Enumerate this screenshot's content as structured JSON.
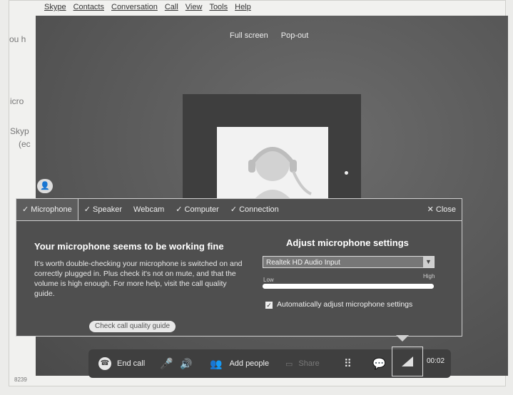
{
  "menu": [
    "Skype",
    "Contacts",
    "Conversation",
    "Call",
    "View",
    "Tools",
    "Help"
  ],
  "side_fragments": [
    "ou h",
    "icro",
    "Skyp",
    "(ec",
    "8239"
  ],
  "video": {
    "full_screen": "Full screen",
    "pop_out": "Pop-out"
  },
  "panel": {
    "tabs": [
      {
        "label": "Microphone",
        "checked": true,
        "active": true
      },
      {
        "label": "Speaker",
        "checked": true,
        "active": false
      },
      {
        "label": "Webcam",
        "checked": false,
        "active": false
      },
      {
        "label": "Computer",
        "checked": true,
        "active": false
      },
      {
        "label": "Connection",
        "checked": true,
        "active": false
      }
    ],
    "close_label": "Close",
    "left_heading": "Your microphone seems to be working fine",
    "left_body": "It's worth double-checking your microphone is switched on and correctly plugged in. Plus check it's not on mute, and that the volume is high enough. For more help, visit the call quality guide.",
    "guide_button": "Check call quality guide",
    "right_heading": "Adjust microphone settings",
    "device_select": "Realtek HD Audio Input",
    "volume_low": "Low",
    "volume_high": "High",
    "volume_level": 1.0,
    "auto_adjust_label": "Automatically adjust microphone settings",
    "auto_adjust_checked": true
  },
  "toolbar": {
    "end_call": "End call",
    "add_people": "Add people",
    "share": "Share",
    "timer": "00:02"
  },
  "icons": [
    "end-call-icon",
    "mute-mic-icon",
    "speaker-icon",
    "add-people-icon",
    "dialpad-icon",
    "chat-icon",
    "call-quality-icon",
    "contact-icon",
    "avatar-silhouette-icon"
  ],
  "colors": {
    "panel_bg": "#4f4f4f",
    "video_bg": "#5c5c5c",
    "toolbar_bg": "#3f3f3f"
  }
}
